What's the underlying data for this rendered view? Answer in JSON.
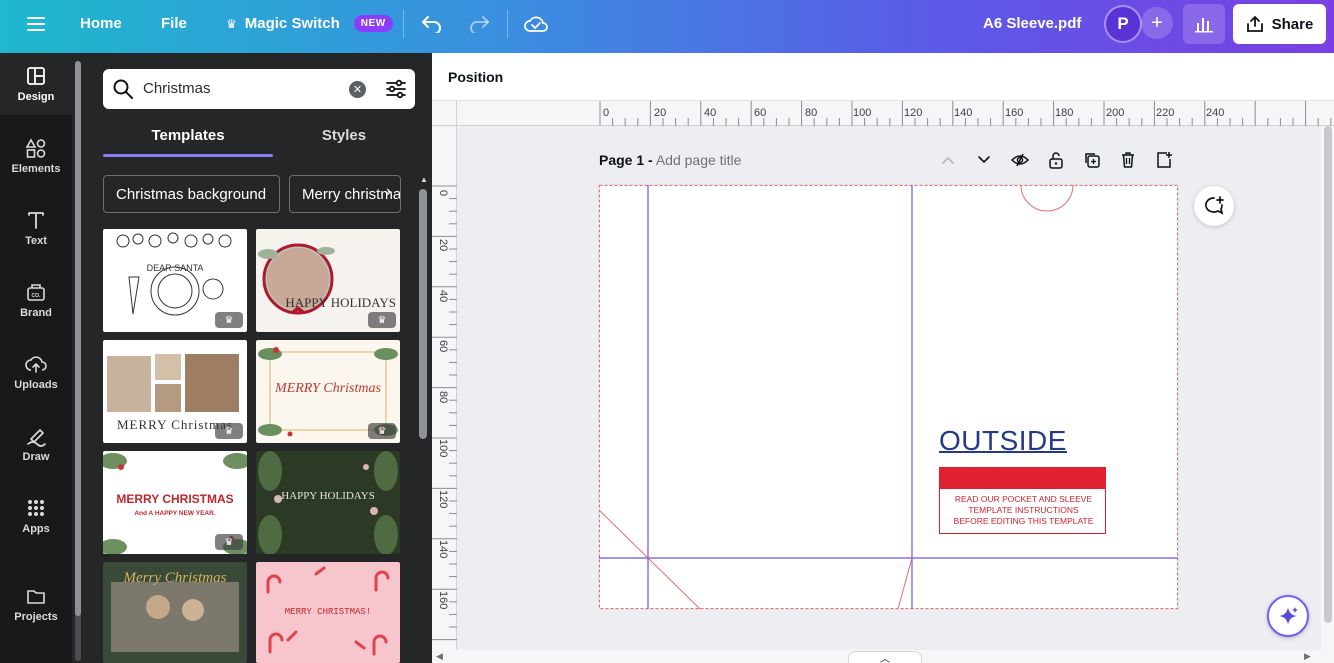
{
  "topbar": {
    "home": "Home",
    "file": "File",
    "magic_switch": "Magic Switch",
    "new_badge": "NEW",
    "doc_title": "A6 Sleeve.pdf",
    "avatar_initial": "P",
    "share": "Share"
  },
  "rail": {
    "items": [
      {
        "label": "Design",
        "icon": "design-icon"
      },
      {
        "label": "Elements",
        "icon": "elements-icon"
      },
      {
        "label": "Text",
        "icon": "text-icon"
      },
      {
        "label": "Brand",
        "icon": "brand-icon"
      },
      {
        "label": "Uploads",
        "icon": "uploads-icon"
      },
      {
        "label": "Draw",
        "icon": "draw-icon"
      },
      {
        "label": "Apps",
        "icon": "apps-icon"
      },
      {
        "label": "Projects",
        "icon": "projects-icon"
      }
    ]
  },
  "panel": {
    "search_value": "Christmas",
    "tabs": [
      "Templates",
      "Styles"
    ],
    "chips": [
      "Christmas background",
      "Merry christmas"
    ],
    "thumbnails": [
      {
        "text": "DEAR SANTA"
      },
      {
        "text": "HAPPY HOLIDAYS"
      },
      {
        "text": "MERRY Christmas"
      },
      {
        "text": "MERRY Christmas"
      },
      {
        "text": "MERRY CHRISTMAS",
        "sub": "And A HAPPY NEW YEAR."
      },
      {
        "text": "HAPPY HOLIDAYS"
      },
      {
        "text": "Merry Christmas"
      },
      {
        "text": "MERRY CHRISTMAS!"
      }
    ]
  },
  "workspace": {
    "position_label": "Position",
    "page_label": "Page 1 -",
    "page_title_placeholder": "Add page title",
    "ruler_h": [
      "0",
      "20",
      "40",
      "60",
      "80",
      "100",
      "120",
      "140",
      "160",
      "180",
      "200",
      "220",
      "240"
    ],
    "ruler_v": [
      "0",
      "20",
      "40",
      "60",
      "80",
      "100",
      "120",
      "140",
      "160"
    ],
    "outside_text": "OUTSIDE",
    "note_lines": [
      "READ OUR POCKET AND SLEEVE",
      "TEMPLATE INSTRUCTIONS",
      "BEFORE EDITING THIS TEMPLATE"
    ]
  },
  "colors": {
    "accent": "#8b3dff",
    "guide": "#6b55e8",
    "red": "#e0202f",
    "outside_blue": "#233a88"
  }
}
